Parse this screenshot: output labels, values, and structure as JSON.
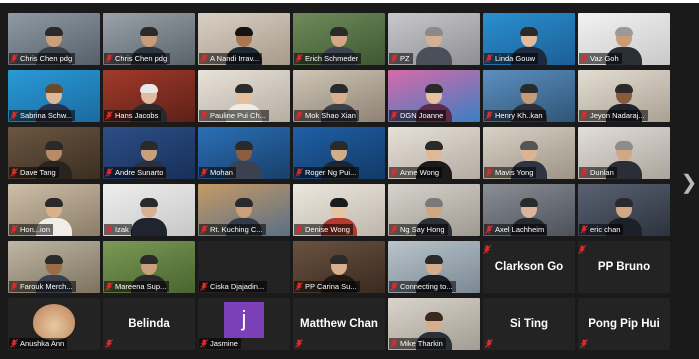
{
  "colors": {
    "background": "#1a1a1a",
    "tile_empty": "#232323",
    "mic_muted": "#e02b2b"
  },
  "next_icon": "chevron-right-icon",
  "participants": [
    {
      "label": "Chris Chen pdg",
      "type": "video",
      "c1": "#8f9aa4",
      "c2": "#55606a",
      "shirt": "#3a3f48",
      "skin": "#caa07c"
    },
    {
      "label": "Chris Chen pdg",
      "type": "video",
      "c1": "#9aa2aa",
      "c2": "#5a626a",
      "shirt": "#2f3540",
      "skin": "#c89c78"
    },
    {
      "label": "A Nandi Irrav...",
      "type": "video",
      "c1": "#d9d0c4",
      "c2": "#a79a8a",
      "shirt": "#1f2933",
      "skin": "#a8774f",
      "hair": "#141414"
    },
    {
      "label": "Erich Schmeder",
      "type": "video",
      "c1": "#6f8c5a",
      "c2": "#3f5634",
      "shirt": "#3c4450",
      "skin": "#d3a886"
    },
    {
      "label": "PZ",
      "type": "video",
      "c1": "#c8c8cc",
      "c2": "#8e8e94",
      "shirt": "#4a4f5a",
      "skin": "#d6b092",
      "hair": "#8a8a8a"
    },
    {
      "label": "Linda Gouw",
      "type": "video",
      "c1": "#2a8fd0",
      "c2": "#1c5f96",
      "shirt": "#1e2a40",
      "skin": "#e2bb9a",
      "logo": "Rotary"
    },
    {
      "label": "Vaz Goh",
      "type": "video",
      "c1": "#f2f2f2",
      "c2": "#c9c9c9",
      "shirt": "#2b2f36",
      "skin": "#c99c76",
      "hair": "#9a9a9a",
      "logo": "Rotary"
    },
    {
      "label": "Sabrina Schw...",
      "type": "video",
      "c1": "#2a9ad6",
      "c2": "#1b6aa0",
      "shirt": "#26324a",
      "skin": "#e0b898",
      "hair": "#6b4a2a",
      "logo": "Rotary"
    },
    {
      "label": "Hans Jacobs",
      "type": "video",
      "c1": "#a23a2a",
      "c2": "#5e2018",
      "shirt": "#2a2a2a",
      "skin": "#e0bba0",
      "hair": "#e8e8e8"
    },
    {
      "label": "Pauline Pui Ch...",
      "type": "video",
      "c1": "#e8e2da",
      "c2": "#b7ada2",
      "shirt": "#f0ece4",
      "skin": "#e3bf9f"
    },
    {
      "label": "Mok Shao Xian",
      "type": "video",
      "c1": "#cfc6b8",
      "c2": "#8d8273",
      "shirt": "#3a3f4a",
      "skin": "#d8b08c"
    },
    {
      "label": "DGN Joanne",
      "type": "video",
      "c1": "#d86aa8",
      "c2": "#3a7fc4",
      "shirt": "#5e2a4a",
      "skin": "#e6c2a2",
      "logo": "Rotary"
    },
    {
      "label": "Henry Kh..kan",
      "type": "video",
      "c1": "#5c8fc0",
      "c2": "#2f5576",
      "shirt": "#2a2f38",
      "skin": "#c69c78"
    },
    {
      "label": "Jeyon Nadaraj...",
      "type": "video",
      "c1": "#e4ddd2",
      "c2": "#aaa194",
      "shirt": "#1f242c",
      "skin": "#8a5a3a"
    },
    {
      "label": "Dave Tang",
      "type": "video",
      "c1": "#6b5642",
      "c2": "#3b2e22",
      "shirt": "#2a2420",
      "skin": "#b98a64"
    },
    {
      "label": "Andre Sunarto",
      "type": "video",
      "c1": "#2d4e86",
      "c2": "#17305a",
      "shirt": "#2a2f3a",
      "skin": "#caa07c"
    },
    {
      "label": "Mohan",
      "type": "video",
      "c1": "#2b6fb6",
      "c2": "#183f6a",
      "shirt": "#3b4150",
      "skin": "#8d5e3e"
    },
    {
      "label": "Roger Ng Pui...",
      "type": "video",
      "c1": "#1f5fa6",
      "c2": "#123a66",
      "shirt": "#1e2430",
      "skin": "#d3ac88"
    },
    {
      "label": "Anne Wong",
      "type": "video",
      "c1": "#e6e0d8",
      "c2": "#b5aca1",
      "shirt": "#1b1b1b",
      "skin": "#e0b896"
    },
    {
      "label": "Mavis Yong",
      "type": "video",
      "c1": "#d8d2c6",
      "c2": "#9c9385",
      "shirt": "#2e3440",
      "skin": "#dcb494",
      "hair": "#555"
    },
    {
      "label": "Dunlan",
      "type": "video",
      "c1": "#e2ded8",
      "c2": "#aaa49c",
      "shirt": "#2a2e36",
      "skin": "#d0a884",
      "hair": "#8c8c8c"
    },
    {
      "label": "Hon...ion",
      "type": "video",
      "c1": "#cdbfa8",
      "c2": "#8a7c66",
      "shirt": "#f0ede6",
      "skin": "#d8b08c"
    },
    {
      "label": "Izak",
      "type": "video",
      "c1": "#eeeeee",
      "c2": "#c7c7c7",
      "shirt": "#1f2430",
      "skin": "#d9b191"
    },
    {
      "label": "Rt. Kuching C...",
      "type": "video",
      "c1": "#c59a66",
      "c2": "#5a6f86",
      "shirt": "#343a46",
      "skin": "#caa07c",
      "logo": "Rotary"
    },
    {
      "label": "Denise Wong",
      "type": "video",
      "c1": "#ece7df",
      "c2": "#bfb6aa",
      "shirt": "#b23a2e",
      "skin": "#e6c4a4",
      "hair": "#1b1b1b"
    },
    {
      "label": "Ng Say Hong",
      "type": "video",
      "c1": "#d6d3cc",
      "c2": "#9e9a92",
      "shirt": "#2b2f36",
      "skin": "#cfa682",
      "hair": "#7a7a7a"
    },
    {
      "label": "Axel Lachheim",
      "type": "video",
      "c1": "#8a8f96",
      "c2": "#4c5158",
      "shirt": "#24282f",
      "skin": "#dcb49a"
    },
    {
      "label": "eric chan",
      "type": "video",
      "c1": "#5a6272",
      "c2": "#2c323e",
      "shirt": "#1c2028",
      "skin": "#d1a886"
    },
    {
      "label": "Farouk Merch...",
      "type": "video",
      "c1": "#bfb6a4",
      "c2": "#7c725f",
      "shirt": "#3a4050",
      "skin": "#9a6c48"
    },
    {
      "label": "Mareena Sup...",
      "type": "video",
      "c1": "#7a9a55",
      "c2": "#4a6430",
      "shirt": "#2a2a2a",
      "skin": "#caa07c"
    },
    {
      "label": "Ciska Djajadin...",
      "type": "empty"
    },
    {
      "label": "PP Carina Su...",
      "type": "video",
      "c1": "#6a5240",
      "c2": "#3a2a20",
      "shirt": "#1f1a16",
      "skin": "#d9b08e"
    },
    {
      "label": "Connecting to...",
      "type": "video",
      "c1": "#b9c4cc",
      "c2": "#7b8893",
      "shirt": "#1b1f26",
      "skin": "#d6ad8a"
    },
    {
      "label": "Clarkson Go",
      "type": "name"
    },
    {
      "label": "PP Bruno",
      "type": "name"
    },
    {
      "label": "Anushka Ann",
      "type": "hamster"
    },
    {
      "label": "Belinda",
      "type": "name",
      "noname": true
    },
    {
      "label": "Jasmine",
      "type": "avatar",
      "initial": "j"
    },
    {
      "label": "Matthew Chan",
      "type": "name",
      "noname": true
    },
    {
      "label": "Mike Tharkin",
      "type": "video",
      "c1": "#d9d4cc",
      "c2": "#a39c92",
      "shirt": "#2a2f38",
      "skin": "#d6ae8c",
      "hair": "#3a2a20"
    },
    {
      "label": "Si Ting",
      "type": "name",
      "noname": true
    },
    {
      "label": "Pong Pip Hui",
      "type": "name",
      "noname": true
    }
  ]
}
